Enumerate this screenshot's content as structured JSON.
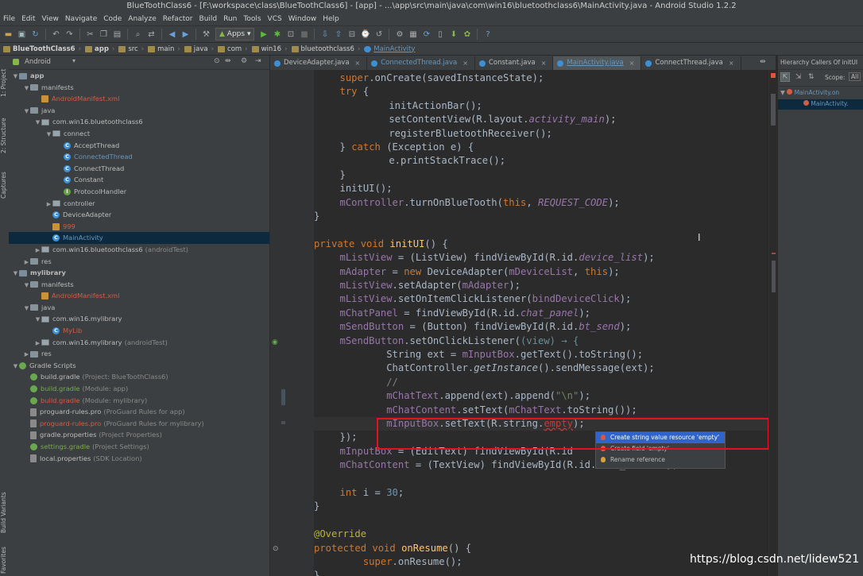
{
  "window": {
    "title": "BlueToothClass6 - [F:\\workspace\\class\\BlueToothClass6] - [app] - ...\\app\\src\\main\\java\\com\\win16\\bluetoothclass6\\MainActivity.java - Android Studio 1.2.2"
  },
  "menu": [
    "File",
    "Edit",
    "View",
    "Navigate",
    "Code",
    "Analyze",
    "Refactor",
    "Build",
    "Run",
    "Tools",
    "VCS",
    "Window",
    "Help"
  ],
  "toolbar": {
    "run_config": "Apps"
  },
  "breadcrumbs": [
    "BlueToothClass6",
    "app",
    "src",
    "main",
    "java",
    "com",
    "win16",
    "bluetoothclass6",
    "MainActivity"
  ],
  "left_tabs": [
    "1: Project",
    "2: Structure",
    "Captures",
    "Build Variants",
    "Favorites"
  ],
  "project": {
    "view_selector": "Android"
  },
  "tree": [
    {
      "depth": 0,
      "arrow": "▼",
      "icon": "mod",
      "label": "app",
      "hint": "",
      "bold": true
    },
    {
      "depth": 1,
      "arrow": "▼",
      "icon": "folder",
      "label": "manifests",
      "hint": ""
    },
    {
      "depth": 2,
      "arrow": "",
      "icon": "xml",
      "label": "AndroidManifest.xml",
      "hint": "",
      "color": "red"
    },
    {
      "depth": 1,
      "arrow": "▼",
      "icon": "folder",
      "label": "java",
      "hint": ""
    },
    {
      "depth": 2,
      "arrow": "▼",
      "icon": "pkg",
      "label": "com.win16.bluetoothclass6",
      "hint": ""
    },
    {
      "depth": 3,
      "arrow": "▼",
      "icon": "pkg",
      "label": "connect",
      "hint": ""
    },
    {
      "depth": 4,
      "arrow": "",
      "icon": "cls",
      "label": "AcceptThread",
      "hint": ""
    },
    {
      "depth": 4,
      "arrow": "",
      "icon": "cls",
      "label": "ConnectedThread",
      "hint": "",
      "color": "blue"
    },
    {
      "depth": 4,
      "arrow": "",
      "icon": "cls",
      "label": "ConnectThread",
      "hint": ""
    },
    {
      "depth": 4,
      "arrow": "",
      "icon": "cls",
      "label": "Constant",
      "hint": ""
    },
    {
      "depth": 4,
      "arrow": "",
      "icon": "itf",
      "label": "ProtocolHandler",
      "hint": ""
    },
    {
      "depth": 3,
      "arrow": "▶",
      "icon": "pkg",
      "label": "controller",
      "hint": ""
    },
    {
      "depth": 3,
      "arrow": "",
      "icon": "cls",
      "label": "DeviceAdapter",
      "hint": ""
    },
    {
      "depth": 3,
      "arrow": "",
      "icon": "xml",
      "label": "999",
      "hint": "",
      "color": "red"
    },
    {
      "depth": 3,
      "arrow": "",
      "icon": "cls",
      "label": "MainActivity",
      "hint": "",
      "color": "blue",
      "selected": true
    },
    {
      "depth": 2,
      "arrow": "▶",
      "icon": "pkg",
      "label": "com.win16.bluetoothclass6",
      "hint": "(androidTest)"
    },
    {
      "depth": 1,
      "arrow": "▶",
      "icon": "folder",
      "label": "res",
      "hint": ""
    },
    {
      "depth": 0,
      "arrow": "▼",
      "icon": "mod",
      "label": "mylibrary",
      "hint": "",
      "bold": true
    },
    {
      "depth": 1,
      "arrow": "▼",
      "icon": "folder",
      "label": "manifests",
      "hint": ""
    },
    {
      "depth": 2,
      "arrow": "",
      "icon": "xml",
      "label": "AndroidManifest.xml",
      "hint": "",
      "color": "red"
    },
    {
      "depth": 1,
      "arrow": "▼",
      "icon": "folder",
      "label": "java",
      "hint": ""
    },
    {
      "depth": 2,
      "arrow": "▼",
      "icon": "pkg",
      "label": "com.win16.mylibrary",
      "hint": ""
    },
    {
      "depth": 3,
      "arrow": "",
      "icon": "cls",
      "label": "MyLib",
      "hint": "",
      "color": "red"
    },
    {
      "depth": 2,
      "arrow": "▶",
      "icon": "pkg",
      "label": "com.win16.mylibrary",
      "hint": "(androidTest)"
    },
    {
      "depth": 1,
      "arrow": "▶",
      "icon": "folder",
      "label": "res",
      "hint": ""
    },
    {
      "depth": 0,
      "arrow": "▼",
      "icon": "grd",
      "label": "Gradle Scripts",
      "hint": ""
    },
    {
      "depth": 1,
      "arrow": "",
      "icon": "grd",
      "label": "build.gradle",
      "hint": "(Project: BlueToothClass6)"
    },
    {
      "depth": 1,
      "arrow": "",
      "icon": "grd",
      "label": "build.gradle",
      "hint": "(Module: app)",
      "color": "green"
    },
    {
      "depth": 1,
      "arrow": "",
      "icon": "grd",
      "label": "build.gradle",
      "hint": "(Module: mylibrary)",
      "color": "red"
    },
    {
      "depth": 1,
      "arrow": "",
      "icon": "doc",
      "label": "proguard-rules.pro",
      "hint": "(ProGuard Rules for app)"
    },
    {
      "depth": 1,
      "arrow": "",
      "icon": "doc",
      "label": "proguard-rules.pro",
      "hint": "(ProGuard Rules for mylibrary)",
      "color": "red"
    },
    {
      "depth": 1,
      "arrow": "",
      "icon": "doc",
      "label": "gradle.properties",
      "hint": "(Project Properties)"
    },
    {
      "depth": 1,
      "arrow": "",
      "icon": "grd",
      "label": "settings.gradle",
      "hint": "(Project Settings)",
      "color": "green"
    },
    {
      "depth": 1,
      "arrow": "",
      "icon": "doc",
      "label": "local.properties",
      "hint": "(SDK Location)"
    }
  ],
  "tabs": [
    {
      "label": "DeviceAdapter.java",
      "active": false
    },
    {
      "label": "ConnectedThread.java",
      "active": false
    },
    {
      "label": "Constant.java",
      "active": false
    },
    {
      "label": "MainActivity.java",
      "active": true
    },
    {
      "label": "ConnectThread.java",
      "active": false
    }
  ],
  "hierarchy": {
    "title": "Hierarchy Callers Of initUI",
    "scope_label": "Scope:",
    "scope_value": "All",
    "items": [
      "MainActivity.on",
      "MainActivity."
    ]
  },
  "code_lines": [
    [
      [
        "kw",
        "super"
      ],
      [
        "",
        "."
      ],
      [
        "fn",
        ""
      ],
      [
        "",
        "onCreate(savedInstanceState);"
      ]
    ],
    [
      [
        "kw",
        "try"
      ],
      [
        "",
        " {"
      ]
    ],
    [
      [
        "",
        "    initActionBar();"
      ]
    ],
    [
      [
        "",
        "    setContentView(R.layout."
      ],
      [
        "fld itl",
        "activity_main"
      ],
      [
        "",
        ");"
      ]
    ],
    [
      [
        "",
        "    registerBluetoothReceiver();"
      ]
    ],
    [
      [
        "",
        "} "
      ],
      [
        "kw",
        "catch"
      ],
      [
        "",
        " (Exception e) {"
      ]
    ],
    [
      [
        "",
        "    e.printStackTrace();"
      ]
    ],
    [
      [
        "",
        "}"
      ]
    ],
    [
      [
        "",
        "initUI();"
      ]
    ],
    [
      [
        "fld",
        "mController"
      ],
      [
        "",
        ".turnOnBlueTooth("
      ],
      [
        "kw",
        "this"
      ],
      [
        "",
        ", "
      ],
      [
        "fld itl",
        "REQUEST_CODE"
      ],
      [
        "",
        ");"
      ]
    ],
    [
      [
        "",
        "}"
      ]
    ],
    [
      [
        "",
        ""
      ]
    ],
    [
      [
        "kw",
        "private void "
      ],
      [
        "fn",
        "initUI"
      ],
      [
        "",
        "() {"
      ]
    ],
    [
      [
        "fld",
        "mListView"
      ],
      [
        "",
        " = (ListView) findViewById(R.id."
      ],
      [
        "fld itl",
        "device_list"
      ],
      [
        "",
        ");"
      ]
    ],
    [
      [
        "fld",
        "mAdapter"
      ],
      [
        "",
        " = "
      ],
      [
        "kw",
        "new"
      ],
      [
        "",
        " DeviceAdapter("
      ],
      [
        "fld",
        "mDeviceList"
      ],
      [
        "",
        ", "
      ],
      [
        "kw",
        "this"
      ],
      [
        "",
        ");"
      ]
    ],
    [
      [
        "fld",
        "mListView"
      ],
      [
        "",
        ".setAdapter("
      ],
      [
        "fld",
        "mAdapter"
      ],
      [
        "",
        ");"
      ]
    ],
    [
      [
        "fld",
        "mListView"
      ],
      [
        "",
        ".setOnItemClickListener("
      ],
      [
        "fld",
        "bindDeviceClick"
      ],
      [
        "",
        ");"
      ]
    ],
    [
      [
        "fld",
        "mChatPanel"
      ],
      [
        "",
        " = findViewById(R.id."
      ],
      [
        "fld itl",
        "chat_panel"
      ],
      [
        "",
        ");"
      ]
    ],
    [
      [
        "fld",
        "mSendButton"
      ],
      [
        "",
        " = (Button) findViewById(R.id."
      ],
      [
        "fld itl",
        "bt_send"
      ],
      [
        "",
        ");"
      ]
    ],
    [
      [
        "fld",
        "mSendButton"
      ],
      [
        "",
        ".setOnClickListener("
      ],
      [
        "param",
        "(view) → {"
      ]
    ],
    [
      [
        "",
        "        String ext = "
      ],
      [
        "fld",
        "mInputBox"
      ],
      [
        "",
        ".getText().toString();"
      ]
    ],
    [
      [
        "",
        "        ChatController."
      ],
      [
        "itl",
        "getInstance"
      ],
      [
        "",
        "().sendMessage(ext);"
      ]
    ],
    [
      [
        "cm",
        "        //"
      ]
    ],
    [
      [
        "fld",
        "        mChatText"
      ],
      [
        "",
        ".append(ext).append("
      ],
      [
        "str",
        "\"\\n\""
      ],
      [
        "",
        ");"
      ]
    ],
    [
      [
        "fld",
        "        mChatContent"
      ],
      [
        "",
        ".setText("
      ],
      [
        "fld",
        "mChatText"
      ],
      [
        "",
        ".toString());"
      ]
    ],
    [
      [
        "fld",
        "        mInputBox"
      ],
      [
        "",
        ".setText(R.string."
      ],
      [
        "red",
        "empty"
      ],
      [
        "",
        ");"
      ]
    ],
    [
      [
        "",
        "});"
      ]
    ],
    [
      [
        "fld",
        "mInputBox"
      ],
      [
        "",
        " = (EditText) findViewById(R.id"
      ]
    ],
    [
      [
        "fld",
        "mChatContent"
      ],
      [
        "",
        " = (TextView) findViewById(R.id.chat_content);"
      ]
    ],
    [
      [
        "",
        ""
      ]
    ],
    [
      [
        "kw",
        "int "
      ],
      [
        "",
        "i = "
      ],
      [
        "num",
        "30"
      ],
      [
        "",
        ";"
      ]
    ],
    [
      [
        "",
        "}"
      ]
    ],
    [
      [
        "",
        ""
      ]
    ],
    [
      [
        "ann",
        "@Override"
      ]
    ],
    [
      [
        "kw",
        "protected void "
      ],
      [
        "fn",
        "onResume"
      ],
      [
        "",
        "() {"
      ]
    ],
    [
      [
        "kw",
        "    super"
      ],
      [
        "",
        ".onResume();"
      ]
    ],
    [
      [
        "",
        "}"
      ]
    ]
  ],
  "code_indent": [
    1,
    1,
    2,
    2,
    2,
    1,
    2,
    1,
    1,
    1,
    0,
    0,
    0,
    1,
    1,
    1,
    1,
    1,
    1,
    1,
    1,
    1,
    1,
    1,
    1,
    1,
    1,
    1,
    1,
    0,
    1,
    0,
    0,
    0,
    0,
    1,
    0
  ],
  "popup": {
    "items": [
      "Create string value resource 'empty'",
      "Create field 'empty'",
      "Rename reference"
    ]
  },
  "watermark": "https://blog.csdn.net/lidew521"
}
